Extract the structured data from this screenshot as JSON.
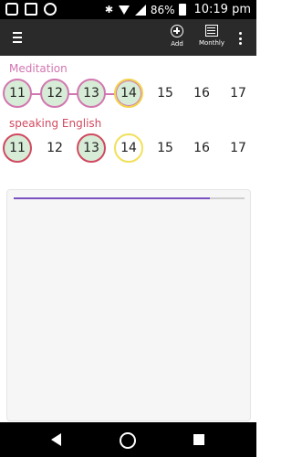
{
  "status_bar": {
    "battery": "86%",
    "time": "10:19 pm"
  },
  "app_bar": {
    "add_label": "Add",
    "monthly_label": "Monthly"
  },
  "habits": [
    {
      "name": "Meditation",
      "color": "#d276b0",
      "days": [
        "11",
        "12",
        "13",
        "14",
        "15",
        "16",
        "17"
      ],
      "completed": [
        true,
        true,
        true,
        true,
        false,
        false,
        false
      ],
      "today_index": 3
    },
    {
      "name": "speaking English",
      "color": "#d14960",
      "days": [
        "11",
        "12",
        "13",
        "14",
        "15",
        "16",
        "17"
      ],
      "completed": [
        true,
        false,
        true,
        false,
        false,
        false,
        false
      ],
      "today_index": 3
    }
  ],
  "card": {
    "progress": 0.85,
    "progress_color": "#7a4fc0"
  },
  "colors": {
    "done_fill": "#d7ecd6",
    "today_ring": "#f2e05a",
    "app_bar": "#2a2a2a"
  }
}
